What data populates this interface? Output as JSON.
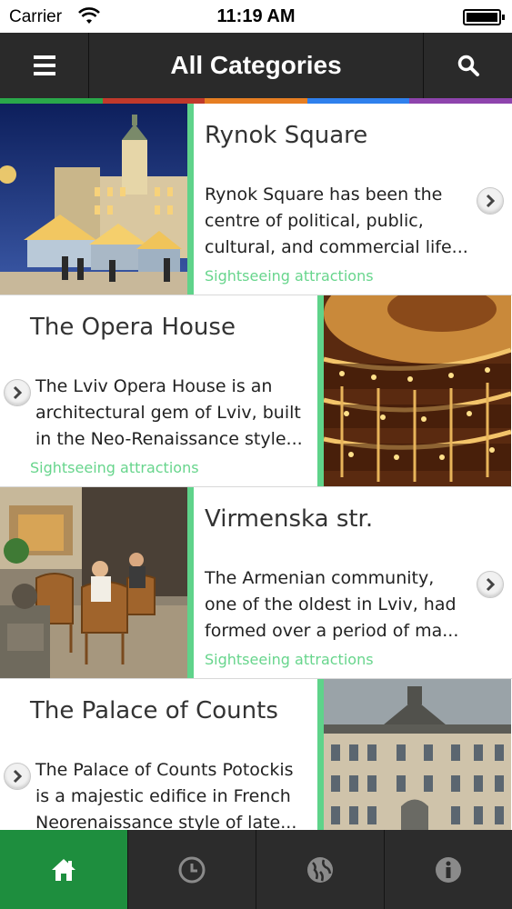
{
  "status_bar": {
    "carrier": "Carrier",
    "time": "11:19 AM"
  },
  "navbar": {
    "title": "All Categories",
    "left_icon": "menu-icon",
    "right_icon": "search-icon"
  },
  "color_strip": [
    "#2aa84a",
    "#c0392b",
    "#e67e22",
    "#2f80ed",
    "#8e44ad"
  ],
  "items": [
    {
      "title": "Rynok Square",
      "description": "Rynok Square has been the centre of political, public, cultural, and commercial life...",
      "description_lines": [
        "Rynok Square has been the",
        "centre of political, public,",
        "cultural, and commercial life..."
      ],
      "category": "Sightseeing attractions",
      "image": "christmas-market-town-hall-night"
    },
    {
      "title": "The Opera House",
      "description": "The Lviv Opera House is an architectural gem of Lviv, built in the Neo-Renaissance style...",
      "description_lines": [
        "The Lviv Opera House is an",
        "architectural gem of Lviv, built",
        "in the Neo-Renaissance style..."
      ],
      "category": "Sightseeing attractions",
      "image": "opera-house-interior"
    },
    {
      "title": "Virmenska str.",
      "description": "The Armenian community, one of the oldest in Lviv, had formed over a period of ma...",
      "description_lines": [
        "The Armenian community,",
        "one of the oldest in Lviv, had",
        "formed over a period of ma..."
      ],
      "category": "Sightseeing attractions",
      "image": "street-cafe"
    },
    {
      "title": "The Palace of Counts",
      "description": "The Palace of Counts Potockis is a majestic edifice in French Neorenaissance style of late...",
      "description_lines": [
        "The Palace of Counts Potockis",
        "is a majestic edifice in French",
        "Neorenaissance style of late..."
      ],
      "category": "",
      "image": "palace-facade"
    }
  ],
  "tabbar": {
    "tabs": [
      {
        "icon": "home-icon",
        "active": true
      },
      {
        "icon": "clock-icon",
        "active": false
      },
      {
        "icon": "globe-icon",
        "active": false
      },
      {
        "icon": "info-icon",
        "active": false
      }
    ]
  },
  "colors": {
    "navbar_bg": "#2a2a2a",
    "accent_green": "#5fd38a",
    "active_tab": "#1e8e3e"
  }
}
